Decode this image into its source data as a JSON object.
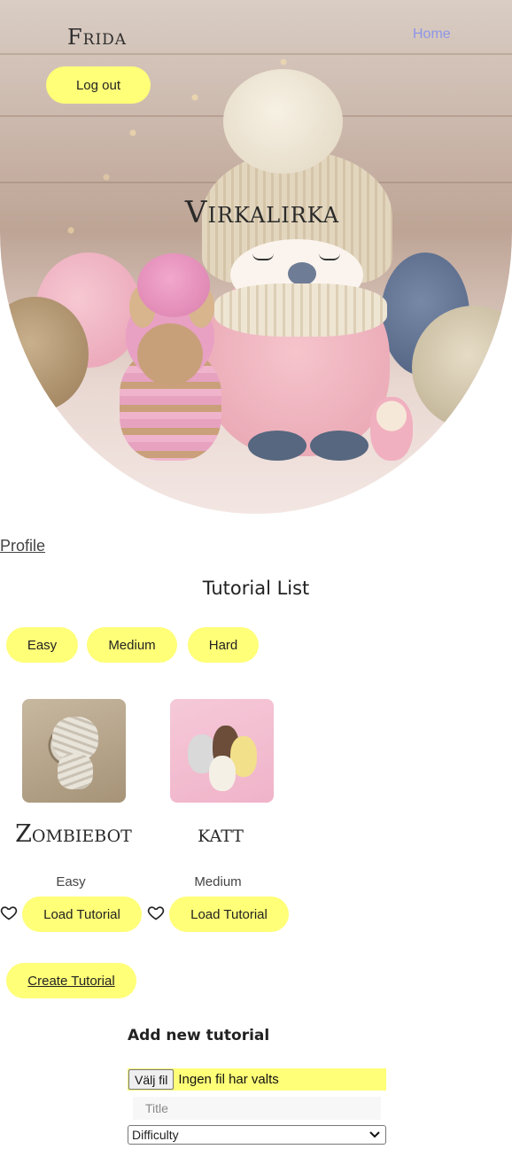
{
  "header": {
    "user_name": "Frida",
    "home_link": "Home",
    "logout_label": "Log out",
    "site_title": "Virkalirka"
  },
  "nav": {
    "profile_link": "Profile"
  },
  "tutorial_list": {
    "title": "Tutorial List",
    "filters": [
      "Easy",
      "Medium",
      "Hard"
    ],
    "items": [
      {
        "title": "Zombiebot",
        "difficulty": "Easy",
        "action_label": "Load Tutorial",
        "favorite_icon": "heart-outline-icon",
        "thumbnail": "zombie-robot-amigurumi"
      },
      {
        "title": "katt",
        "difficulty": "Medium",
        "action_label": "Load Tutorial",
        "favorite_icon": "heart-outline-icon",
        "thumbnail": "cat-amigurumi-group"
      }
    ],
    "create_label": "Create Tutorial"
  },
  "new_tutorial_form": {
    "heading": "Add new tutorial",
    "file_button": "Välj fil",
    "file_status": "Ingen fil har valts",
    "title_placeholder": "Title",
    "difficulty_selected": "Difficulty"
  },
  "colors": {
    "accent_yellow": "#ffff78",
    "home_link": "#8d96e8"
  }
}
